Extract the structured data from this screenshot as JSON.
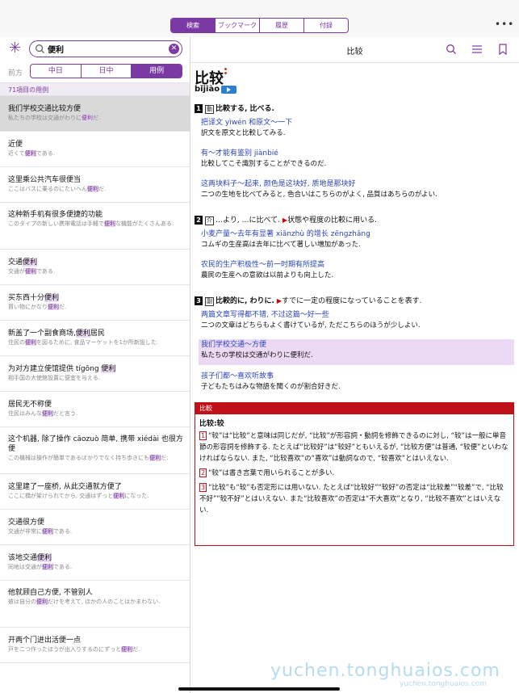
{
  "top_tabs": [
    {
      "label": "検索",
      "active": true
    },
    {
      "label": "ブックマーク",
      "active": false
    },
    {
      "label": "履歴",
      "active": false
    },
    {
      "label": "付録",
      "active": false
    }
  ],
  "more_icon": "more-horizontal-icon",
  "search": {
    "value": "便利"
  },
  "mode_label": "前方",
  "modes": [
    {
      "label": "中日",
      "active": false
    },
    {
      "label": "日中",
      "active": false
    },
    {
      "label": "用例",
      "active": true
    }
  ],
  "result_count": "71項目の用例",
  "results": [
    {
      "zh": [
        "我们学校交通比较方便",
        ""
      ],
      "jp": [
        "私たちの学校は交通がわりに",
        "便利",
        "だ."
      ],
      "selected": true
    },
    {
      "zh": [
        "近便",
        ""
      ],
      "jp": [
        "近くて",
        "便利",
        "である."
      ]
    },
    {
      "zh": [
        "这里乘公共汽车很便当",
        ""
      ],
      "jp": [
        "ここはバスに乗るのにたいへん",
        "便利",
        "だ."
      ]
    },
    {
      "zh": [
        "这种新手机有很多便捷的功能",
        ""
      ],
      "jp": [
        "このタイプの新しい携帯電話は手軽で",
        "便利",
        "な機能がたくさんある."
      ]
    },
    {
      "zh": [
        "交通",
        "便利"
      ],
      "jp": [
        "交通が",
        "便利",
        "である."
      ]
    },
    {
      "zh": [
        "买东西十分",
        "便利"
      ],
      "jp": [
        "買い物にかなり",
        "便利",
        "だ."
      ]
    },
    {
      "zh": [
        "新盖了一个副食商场,",
        "便利",
        "居民"
      ],
      "jp": [
        "住民の",
        "便利",
        "を図るために, 食品マーケットを1か所新設した."
      ]
    },
    {
      "zh": [
        "为对方建立使馆提供 tígōng ",
        "便利"
      ],
      "jp": [
        "相手国の大使館設置に便宜を与える."
      ]
    },
    {
      "zh": [
        "居民无不称便",
        ""
      ],
      "jp": [
        "住民はみんな",
        "便利",
        "だと言う."
      ]
    },
    {
      "zh": [
        "这个机器, 除了操作 cāozuò 简单, 携带 xiédài 也很方便",
        ""
      ],
      "jp": [
        "この機械は操作が簡単であるばかりでなく持ち歩きにも",
        "便利",
        "だ."
      ]
    },
    {
      "zh": [
        "这里建了一座桥, 从此交通就方便了",
        ""
      ],
      "jp": [
        "ここに橋が架けられてから, 交通はずっと",
        "便利",
        "になった."
      ]
    },
    {
      "zh": [
        "交通很方便",
        ""
      ],
      "jp": [
        "交通が非常に",
        "便利",
        "である."
      ]
    },
    {
      "zh": [
        "该地交通",
        "便利"
      ],
      "jp": [
        "同地は交通が",
        "便利",
        "である."
      ]
    },
    {
      "zh": [
        "他就顾自己方便, 不管别人",
        ""
      ],
      "jp": [
        "彼は自分の",
        "便利",
        "だけを考えて, ほかの人のことはかまわない."
      ]
    },
    {
      "zh": [
        "开两个门进出活便一点",
        ""
      ],
      "jp": [
        "戸を二つ作ったほうが出入りするのにずっと",
        "便利",
        "だ."
      ]
    }
  ],
  "detail": {
    "header_title": "比较",
    "headword": "比较",
    "pinyin": "bǐjiào",
    "senses": [
      {
        "num": "1",
        "pos": "動",
        "text": "比較する, 比べる."
      },
      {
        "num": "2",
        "pos": "介",
        "text": "…より, …に比べて.",
        "note": "状態や程度の比較に用いる."
      },
      {
        "num": "3",
        "pos": "副",
        "text": "比較的に, わりに.",
        "note": "すでに一定の程度になっていることを表す."
      }
    ],
    "examples": [
      {
        "c": "把译文 yìwén 和原文〜一下",
        "j": "訳文を原文と比較してみる."
      },
      {
        "c": "有〜才能有鉴别 jiànbié",
        "j": "比較してこそ識別することができるのだ."
      },
      {
        "c": "这两块料子〜起来, 颜色是这块好, 质地是那块好",
        "j": "二つの生地を比べてみると, 色合いはこちらのがよく, 品質はあちらのがよい."
      },
      {
        "c": "小麦产量〜去年有显著 xiǎnzhù 的增长 zēngzhǎng",
        "j": "コムギの生産高は去年に比べて著しい増加があった."
      },
      {
        "c": "农民的生产积极性〜前一时期有所提高",
        "j": "農民の生産への意欲は以前よりも向上した."
      },
      {
        "c": "两篇文章写得都不错, 不过这篇〜好一些",
        "j": "二つの文章はどちらもよく書けているが, ただこちらのほうが少しよい."
      },
      {
        "c": "我们学校交通〜方便",
        "j": "私たちの学校は交通がわりに便利だ."
      },
      {
        "c": "孩子们都〜喜欢听故事",
        "j": "子どもたちはみな物語を聞くのが割合好きだ."
      }
    ],
    "note_header": "比較",
    "note_title": "比较:较",
    "notes": [
      {
        "n": "1",
        "t": "“较”は“比较”と意味は同じだが, “比较”が形容詞・動詞を修飾できるのに対し, “较”は一般に単音節の形容詞を修飾する. たとえば“比较好”は“较好”ともいえるが, “比较方便”は普通, “较便”といわなければならない. また, “比较喜欢”の“喜欢”は動詞なので, “较喜欢”とはいえない."
      },
      {
        "n": "2",
        "t": "“较”は書き言葉で用いられることが多い."
      },
      {
        "n": "3",
        "t": "“比较”も“较”も否定形には用いない. たとえば“比较好”“较好”の否定は“比较差”“较差”で, “比较不好”“较不好”とはいえない. また“比较喜欢”の否定は“不大喜欢”となり, “比较不喜欢”とはいえない."
      }
    ]
  },
  "watermark": "yuchen.tonghuaios.com",
  "watermark_small": "yuchen.tonghuaios.com"
}
